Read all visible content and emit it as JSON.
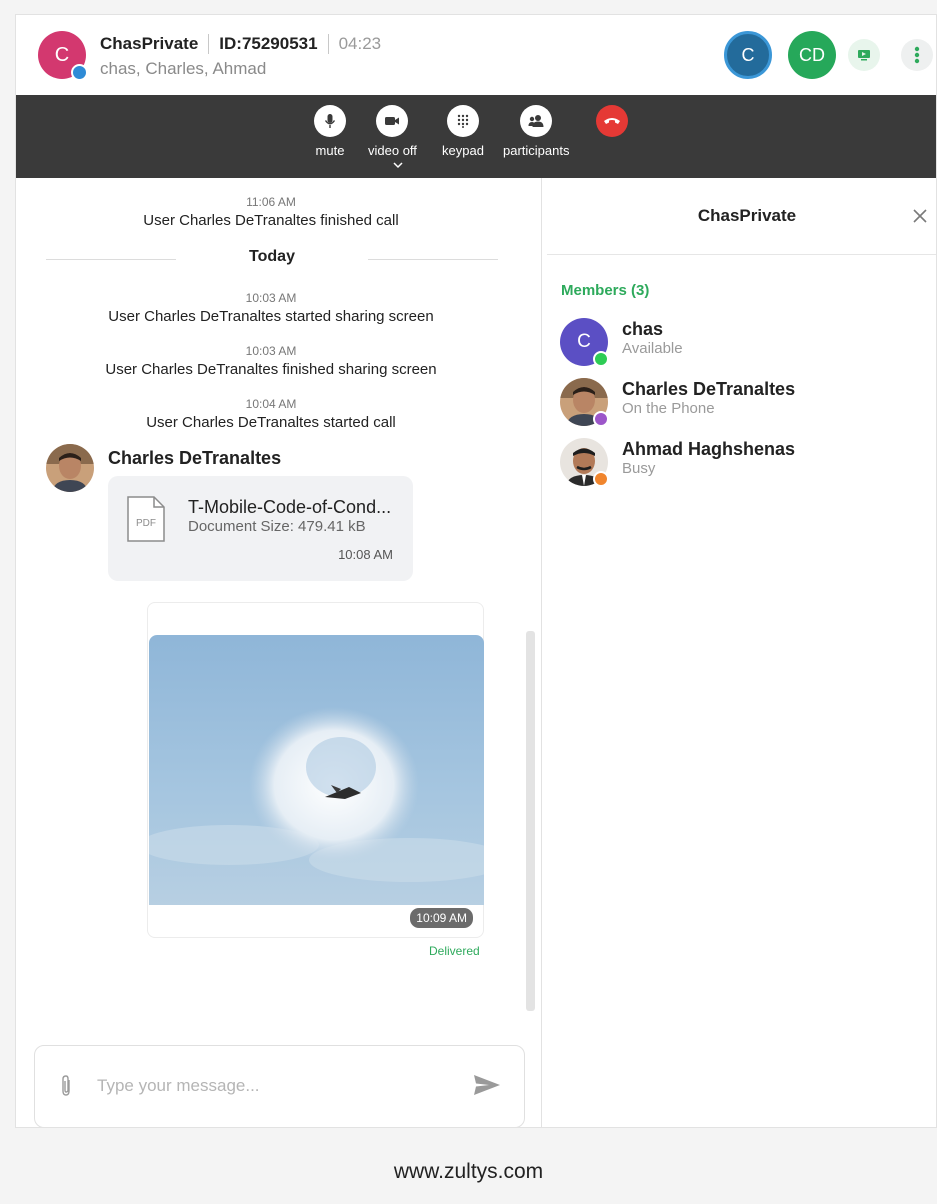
{
  "header": {
    "avatar_letter": "C",
    "title": "ChasPrivate",
    "id_label": "ID:75290531",
    "timer": "04:23",
    "participants": "chas, Charles, Ahmad",
    "active_avatar_c": "C",
    "active_avatar_cd": "CD"
  },
  "toolbar": {
    "mute": "mute",
    "video": "video off",
    "keypad": "keypad",
    "participants": "participants"
  },
  "chat": {
    "events": [
      {
        "time": "11:06 AM",
        "text": "User Charles DeTranaltes finished call"
      },
      {
        "time": "10:03 AM",
        "text": "User Charles DeTranaltes started sharing screen"
      },
      {
        "time": "10:03 AM",
        "text": "User Charles DeTranaltes finished sharing screen"
      },
      {
        "time": "10:04 AM",
        "text": "User Charles DeTranaltes started call"
      }
    ],
    "day_divider": "Today",
    "sender_name": "Charles DeTranaltes",
    "file": {
      "icon_label": "PDF",
      "name": "T-Mobile-Code-of-Cond...",
      "size": "Document Size: 479.41 kB",
      "time": "10:08 AM"
    },
    "image_time": "10:09 AM",
    "delivered": "Delivered",
    "composer_placeholder": "Type your message..."
  },
  "panel": {
    "title": "ChasPrivate",
    "members_heading": "Members (3)",
    "members": [
      {
        "name": "chas",
        "status": "Available",
        "letter": "C",
        "status_color": "#2ecc55"
      },
      {
        "name": "Charles DeTranaltes",
        "status": "On the Phone",
        "status_color": "#9c56c9"
      },
      {
        "name": "Ahmad Haghshenas",
        "status": "Busy",
        "status_color": "#f0852d"
      }
    ]
  },
  "footer": {
    "url": "www.zultys.com"
  },
  "colors": {
    "accent_green": "#2eaa5c",
    "hangup_red": "#e53935",
    "toolbar_bg": "#3a3a3a"
  }
}
